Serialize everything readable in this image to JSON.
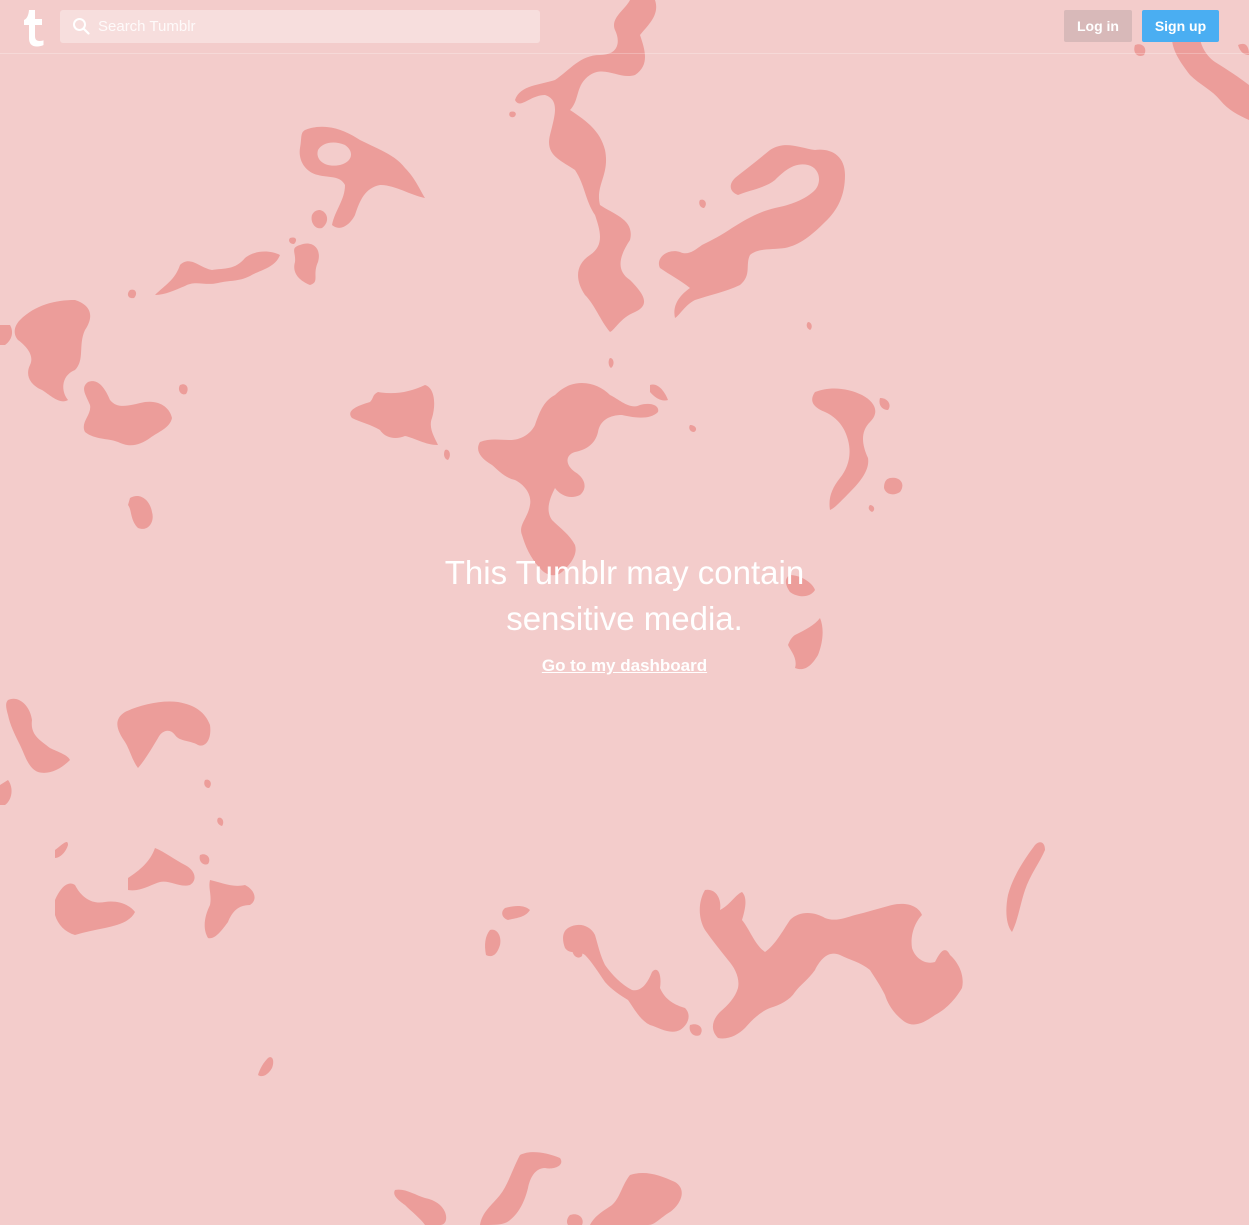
{
  "header": {
    "logo_icon": "tumblr-t-logo-icon",
    "search": {
      "placeholder": "Search Tumblr",
      "value": "",
      "icon": "search-icon"
    },
    "login_label": "Log in",
    "signup_label": "Sign up"
  },
  "notice": {
    "title": "This Tumblr may contain sensitive media.",
    "link_label": "Go to my dashboard"
  },
  "colors": {
    "background": "#f3cccb",
    "blob": "#ec9d9a",
    "login_button": "#d8b9b9",
    "signup_button": "#4aaef2",
    "text": "#ffffff"
  }
}
